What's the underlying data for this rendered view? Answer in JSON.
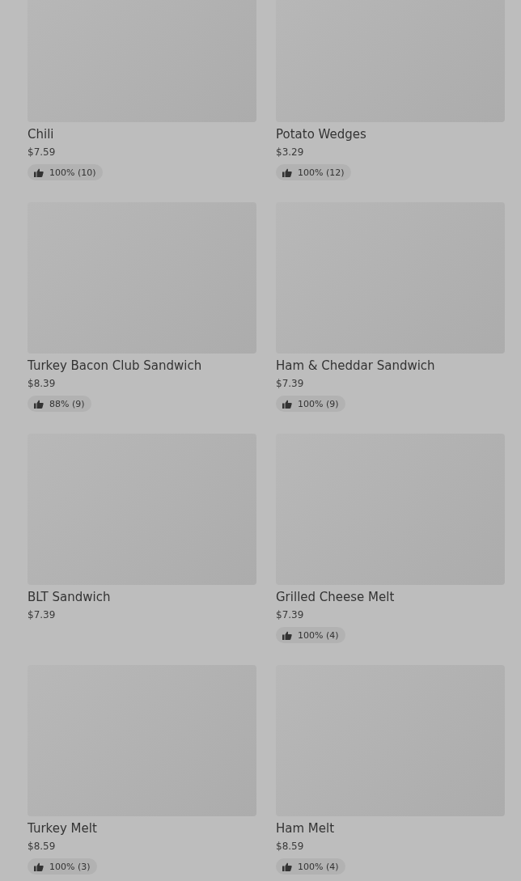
{
  "menu_items": [
    {
      "name": "Chili",
      "price": "$7.59",
      "rating": "100% (10)"
    },
    {
      "name": "Potato Wedges",
      "price": "$3.29",
      "rating": "100% (12)"
    },
    {
      "name": "Turkey Bacon Club Sandwich",
      "price": "$8.39",
      "rating": "88% (9)"
    },
    {
      "name": "Ham & Cheddar Sandwich",
      "price": "$7.39",
      "rating": "100% (9)"
    },
    {
      "name": "BLT Sandwich",
      "price": "$7.39"
    },
    {
      "name": "Grilled Cheese Melt",
      "price": "$7.39",
      "rating": "100% (4)"
    },
    {
      "name": "Turkey Melt",
      "price": "$8.59",
      "rating": "100% (3)"
    },
    {
      "name": "Ham Melt",
      "price": "$8.59",
      "rating": "100% (4)"
    }
  ]
}
